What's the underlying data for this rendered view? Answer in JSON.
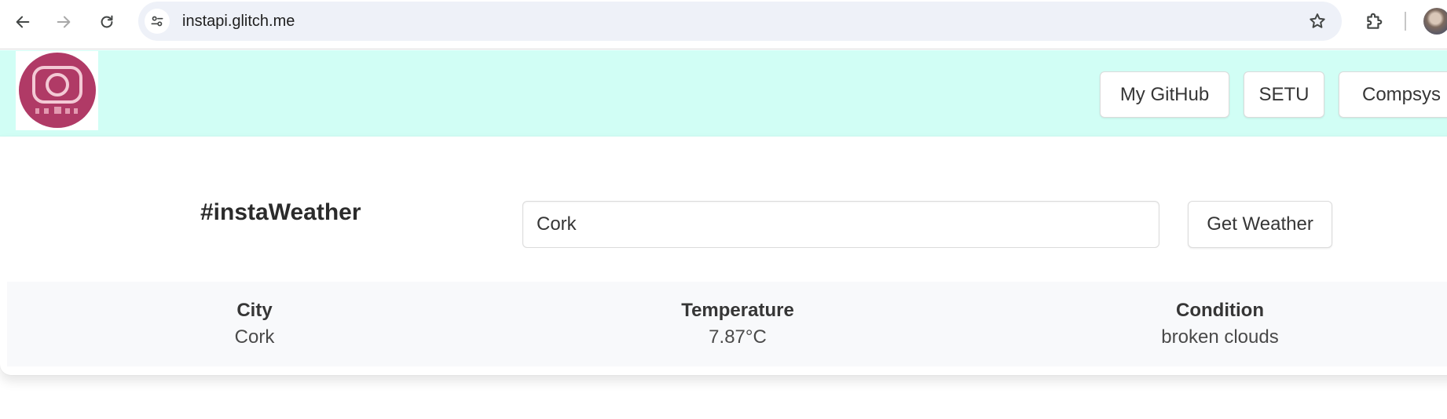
{
  "browser": {
    "url": "instapi.glitch.me",
    "icons": {
      "back": "arrow-left-icon",
      "forward": "arrow-right-icon",
      "reload": "reload-icon",
      "site_info": "tune-icon",
      "bookmark": "star-icon",
      "extensions": "puzzle-icon",
      "profile": "avatar"
    }
  },
  "header": {
    "logo": "instagram-camera-logo",
    "nav_buttons": [
      "My GitHub",
      "SETU",
      "Compsys"
    ]
  },
  "main": {
    "title": "#instaWeather",
    "search": {
      "value": "Cork",
      "button_label": "Get Weather"
    },
    "results": {
      "city": {
        "heading": "City",
        "value": "Cork"
      },
      "temperature": {
        "heading": "Temperature",
        "value": "7.87°C"
      },
      "condition": {
        "heading": "Condition",
        "value": "broken clouds"
      }
    }
  },
  "colors": {
    "header_bg": "#d1fef5",
    "logo_accent": "#b03a66",
    "results_bg": "#f8f9fb",
    "omnibox_bg": "#eef1f8"
  }
}
